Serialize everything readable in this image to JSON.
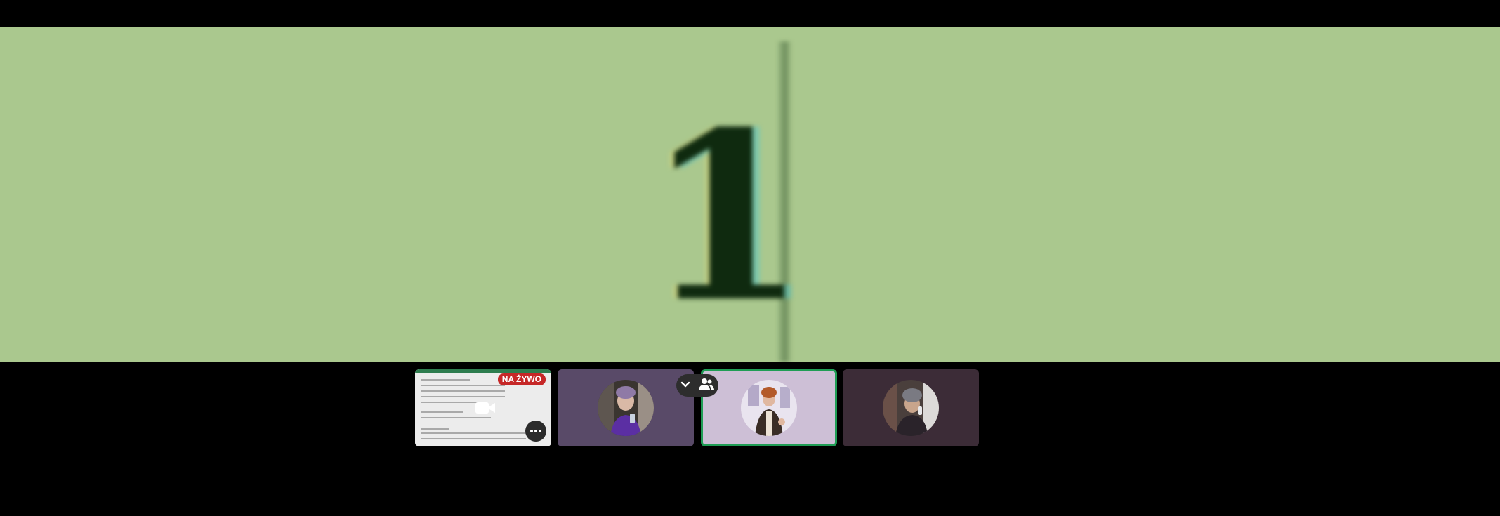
{
  "main_stage": {
    "content": "1"
  },
  "filmstrip": {
    "screen_share": {
      "badge": "NA ŻYWO",
      "icon": "camera-icon",
      "more_icon": "more-icon"
    },
    "participants": [
      {
        "name_visible": false,
        "tile_color": "#594a68"
      },
      {
        "name_visible": false,
        "tile_color": "#cdbfd6",
        "active_speaker": true
      },
      {
        "name_visible": false,
        "tile_color": "#3c2c37"
      }
    ],
    "controls": {
      "collapse_icon": "chevron-down-icon",
      "people_icon": "people-icon"
    }
  },
  "colors": {
    "stage_bg": "#aac88e",
    "live": "#c62828",
    "speaking_border": "#1f9d55"
  }
}
